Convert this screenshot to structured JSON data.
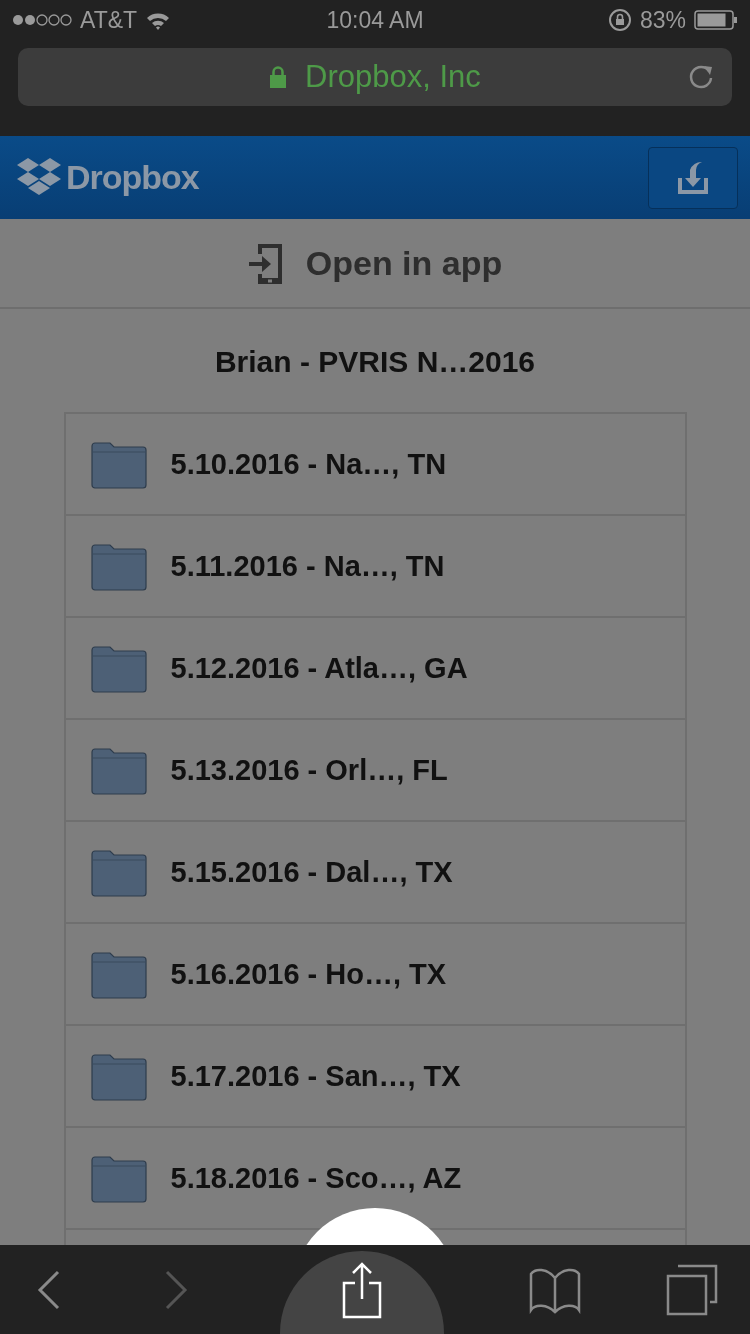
{
  "status_bar": {
    "carrier": "AT&T",
    "time": "10:04 AM",
    "battery": "83%"
  },
  "address_bar": {
    "title": "Dropbox, Inc"
  },
  "header": {
    "logo": "Dropbox"
  },
  "open_in_app": {
    "label": "Open in app"
  },
  "folder": {
    "title": "Brian - PVRIS N…2016"
  },
  "items": [
    {
      "name": "5.10.2016 - Na…, TN"
    },
    {
      "name": "5.11.2016 - Na…, TN"
    },
    {
      "name": "5.12.2016 - Atla…, GA"
    },
    {
      "name": "5.13.2016 - Orl…, FL"
    },
    {
      "name": "5.15.2016 - Dal…, TX"
    },
    {
      "name": "5.16.2016 - Ho…, TX"
    },
    {
      "name": "5.17.2016 - San…, TX"
    },
    {
      "name": "5.18.2016 - Sco…, AZ"
    }
  ],
  "toolbar": {
    "back": {
      "disabled": false
    },
    "forward": {
      "disabled": true
    }
  }
}
